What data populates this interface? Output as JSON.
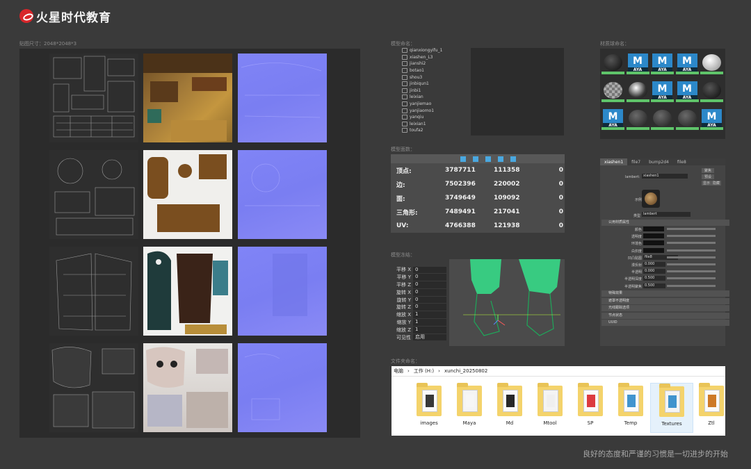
{
  "brand": {
    "name": "火星时代教育"
  },
  "labels": {
    "uv_section": "贴图尺寸：2048*2048*3",
    "outliner_section": "模型命名：",
    "stats_section": "模型面数：",
    "transform_section": "模型冻结：",
    "hyper_section": "材质球命名：",
    "folder_section": "文件夹命名："
  },
  "outliner": {
    "items": [
      "qianxiongyifu_1",
      "xiashen_L3",
      "jianshi2",
      "botao1",
      "shou3",
      "jinbiqun1",
      "jinbi1",
      "leixian",
      "yanjiemao",
      "yanjiaomo1",
      "yanqiu",
      "leixian1",
      "toufa2"
    ]
  },
  "stats": {
    "rows": [
      {
        "label": "顶点:",
        "a": "3787711",
        "b": "111358",
        "c": "0"
      },
      {
        "label": "边:",
        "a": "7502396",
        "b": "220002",
        "c": "0"
      },
      {
        "label": "面:",
        "a": "3749649",
        "b": "109092",
        "c": "0"
      },
      {
        "label": "三角形:",
        "a": "7489491",
        "b": "217041",
        "c": "0"
      },
      {
        "label": "UV:",
        "a": "4766388",
        "b": "121938",
        "c": "0"
      }
    ]
  },
  "channel_box": {
    "rows": [
      {
        "k": "平移 X",
        "v": "0"
      },
      {
        "k": "平移 Y",
        "v": "0"
      },
      {
        "k": "平移 Z",
        "v": "0"
      },
      {
        "k": "旋转 X",
        "v": "0"
      },
      {
        "k": "旋转 Y",
        "v": "0"
      },
      {
        "k": "旋转 Z",
        "v": "0"
      },
      {
        "k": "缩放 X",
        "v": "1"
      },
      {
        "k": "缩放 Y",
        "v": "1"
      },
      {
        "k": "缩放 Z",
        "v": "1"
      },
      {
        "k": "可见性",
        "v": "启用"
      }
    ]
  },
  "hypershade": {
    "tile_label": "AYA",
    "tile_letter": "M"
  },
  "attr": {
    "tabs": [
      "xiashen1",
      "file7",
      "bump2d4",
      "file8"
    ],
    "lambert_label": "lambert:",
    "lambert_value": "xiashen1",
    "btn_focus": "聚焦",
    "btn_preset": "预设",
    "btn_show": "显示",
    "btn_hide": "隐藏",
    "sample_label": "示例",
    "type_label": "类型",
    "type_value": "lambert",
    "section_common": "公用材质属性",
    "attrs": [
      "颜色",
      "透明度",
      "环境色",
      "白炽度",
      "凹凸贴图",
      "漫反射",
      "半透明",
      "半透明深度",
      "半透明聚焦"
    ],
    "bump_value": "file8",
    "values": [
      "0.000",
      "0.000",
      "0.500",
      "0.500"
    ],
    "sections": [
      "特殊效果",
      "遮罩不透明度",
      "光线跟踪选项",
      "节点状态",
      "UUID"
    ]
  },
  "explorer": {
    "path": [
      "电脑",
      "工作 (H:)",
      "xunchi_20250802"
    ],
    "folders": [
      "images",
      "Maya",
      "Md",
      "Mtool",
      "SP",
      "Temp",
      "Textures",
      "Ztl"
    ]
  },
  "footer": {
    "text": "良好的态度和严谨的习惯是一切进步的开始"
  }
}
